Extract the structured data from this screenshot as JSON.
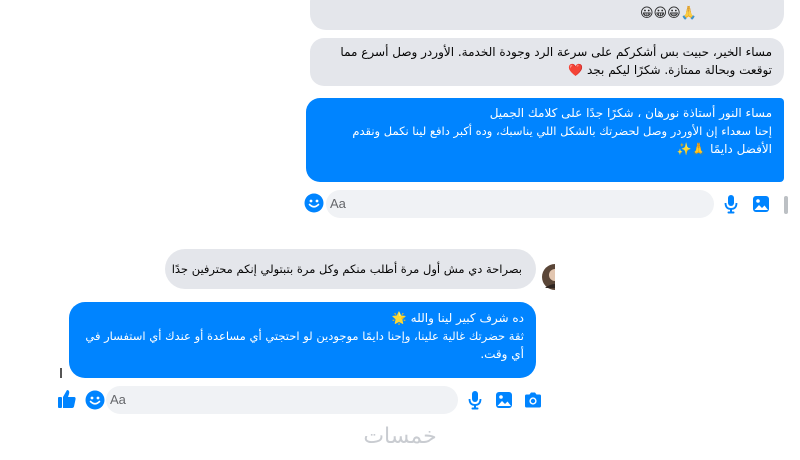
{
  "chat1": {
    "top_emoji_row": "😀😀😀🙏",
    "incoming": {
      "line1": "مساء الخير، حبيت بس أشكركم على سرعة الرد وجودة الخدمة. الأوردر وصل أسرع مما",
      "line2": "توقعت وبحالة ممتازة. شكرًا ليكم بجد",
      "emoji": "❤️"
    },
    "outgoing": {
      "line1": "مساء النور أستاذة نورهان ، شكرًا جدًا على كلامك الجميل",
      "line2": "إحنا سعداء إن الأوردر وصل لحضرتك بالشكل اللي يناسبك، وده أكبر دافع لينا نكمل ونقدم",
      "line3": "الأفضل دايمًا",
      "emoji": "🙏✨"
    },
    "composer": {
      "placeholder": "Aa"
    }
  },
  "chat2": {
    "incoming": {
      "text": "بصراحة دي مش أول مرة أطلب منكم وكل مرة بتبتولي إنكم محترفين جدًا"
    },
    "outgoing": {
      "line1": "ده شرف كبير لينا والله",
      "line1_emoji": "🌟",
      "line2": "ثقة حضرتك غالية علينا، وإحنا دايمًا موجودين لو احتجتي أي مساعدة أو عندك أي استفسار في",
      "line3": "أي وقت."
    },
    "composer": {
      "placeholder": "Aa"
    }
  },
  "watermark": "خمسات",
  "colors": {
    "messenger_blue": "#0084ff",
    "incoming_gray": "#e4e6eb",
    "composer_bg": "#f0f2f5"
  },
  "icons": [
    "smiley-icon",
    "microphone-icon",
    "image-icon",
    "camera-icon",
    "like-icon",
    "avatar"
  ]
}
